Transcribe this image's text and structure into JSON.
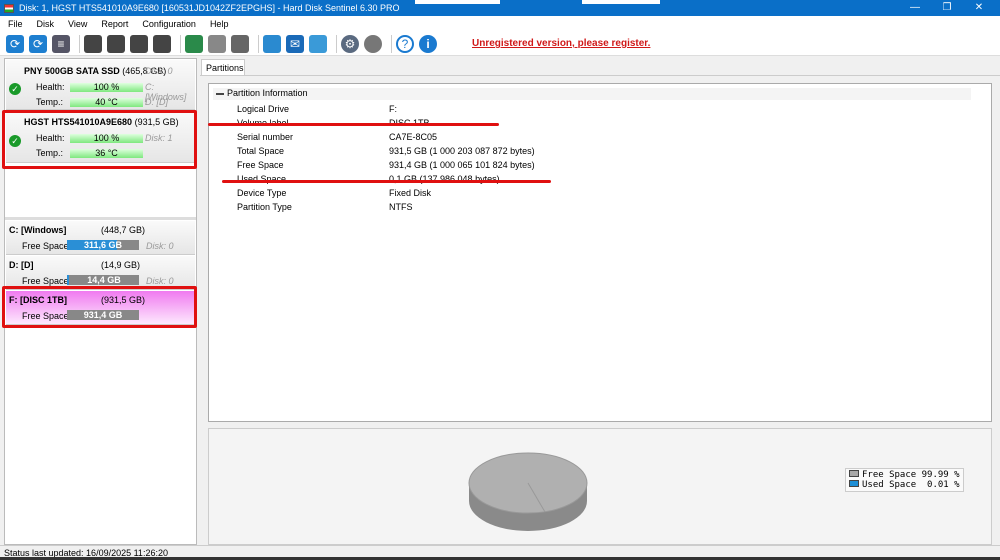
{
  "window": {
    "title": "Disk: 1, HGST HTS541010A9E680 [160531JD1042ZF2EPGHS]  -  Hard Disk Sentinel 6.30 PRO",
    "minimize": "—",
    "maximize": "❐",
    "close": "✕"
  },
  "menu": [
    "File",
    "Disk",
    "View",
    "Report",
    "Configuration",
    "Help"
  ],
  "toolbar": {
    "register_link": "Unregistered version, please register."
  },
  "disks": [
    {
      "name": "PNY 500GB SATA SSD",
      "size": "(465,8 GB)",
      "disk": "Disk: 0",
      "health_label": "Health:",
      "health": "100 %",
      "temp_label": "Temp.:",
      "temp": "40 °C",
      "part1": "C: [Windows]",
      "part2": "D: [D]"
    },
    {
      "name": "HGST HTS541010A9E680",
      "size": "(931,5 GB)",
      "disk": "Disk: 1",
      "health_label": "Health:",
      "health": "100 %",
      "temp_label": "Temp.:",
      "temp": "36 °C"
    }
  ],
  "partitions": [
    {
      "name": "C: [Windows]",
      "size": "(448,7 GB)",
      "free_label": "Free Space",
      "free": "311,6 GB",
      "free_fraction": 0.694,
      "disk": "Disk: 0"
    },
    {
      "name": "D: [D]",
      "size": "(14,9 GB)",
      "free_label": "Free Space",
      "free": "14,4 GB",
      "free_fraction": 0.966,
      "disk": "Disk: 0"
    },
    {
      "name": "F: [DISC 1TB]",
      "size": "(931,5 GB)",
      "free_label": "Free Space",
      "free": "931,4 GB",
      "free_fraction": 0.9999
    }
  ],
  "tab": "Partitions",
  "info": {
    "header": "Partition Information",
    "rows": [
      {
        "k": "Logical Drive",
        "v": "F:"
      },
      {
        "k": "Volume label",
        "v": "DISC 1TB"
      },
      {
        "k": "Serial number",
        "v": "CA7E-8C05"
      },
      {
        "k": "Total Space",
        "v": "931,5 GB (1 000 203 087 872 bytes)"
      },
      {
        "k": "Free Space",
        "v": "931,4 GB (1 000 065 101 824 bytes)"
      },
      {
        "k": "Used Space",
        "v": "0,1 GB (137 986 048 bytes)"
      },
      {
        "k": "Device Type",
        "v": "Fixed Disk"
      },
      {
        "k": "Partition Type",
        "v": "NTFS"
      }
    ]
  },
  "legend": {
    "free": "Free Space 99.99 %",
    "used": "Used Space  0.01 %",
    "free_color": "#a8a8a8",
    "used_color": "#1e8fd6"
  },
  "status": "Status last updated: 16/09/2025 11:26:20"
}
